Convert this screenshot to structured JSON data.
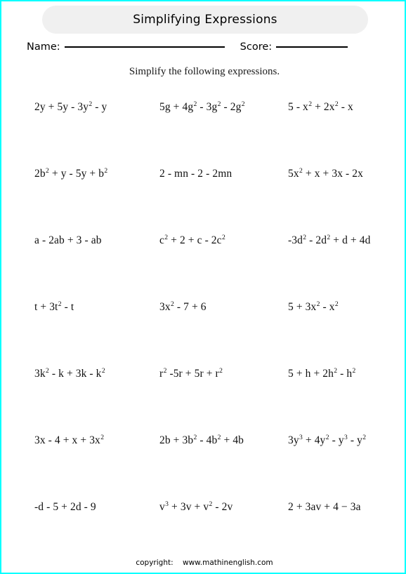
{
  "page": {
    "border_color": "#00ffff",
    "background_color": "#ffffff"
  },
  "header": {
    "title": "Simplifying Expressions",
    "pill_color": "#f0f0f0",
    "name_label": "Name:",
    "score_label": "Score:"
  },
  "instruction": "Simplify the following expressions.",
  "problems": {
    "rows": [
      {
        "col1": "2y + 5y - 3y² - y",
        "col2": "5g + 4g² - 3g² - 2g²",
        "col3": "5 - x² + 2x² - x"
      },
      {
        "col1": "2b² + y - 5y + b²",
        "col2": "2 - mn - 2 - 2mn",
        "col3": "5x² + x + 3x - 2x"
      },
      {
        "col1": "a - 2ab + 3 - ab",
        "col2": "c² + 2 + c - 2c²",
        "col3": "-3d² - 2d² + d + 4d"
      },
      {
        "col1": "t + 3t² - t",
        "col2": "3x² - 7 + 6",
        "col3": "5 + 3x² - x²"
      },
      {
        "col1": "3k² - k + 3k - k²",
        "col2": "r² -5r + 5r + r²",
        "col3": "5 + h + 2h² - h²"
      },
      {
        "col1": "3x - 4 + x + 3x²",
        "col2": "2b + 3b² - 4b² + 4b",
        "col3": "3y³ + 4y² - y³ - y²"
      },
      {
        "col1": "-d - 5 + 2d - 9",
        "col2": "v³ + 3v + v² - 2v",
        "col3": "2 + 3av + 4 − 3a"
      }
    ]
  },
  "footer": {
    "copyright_label": "copyright:",
    "website": "www.mathinenglish.com"
  }
}
